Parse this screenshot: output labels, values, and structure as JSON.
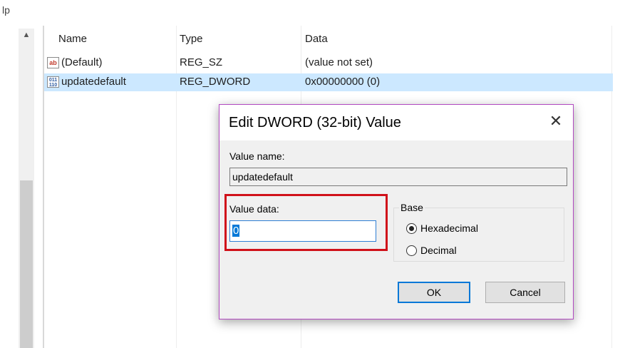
{
  "menu": {
    "fragment": "lp"
  },
  "list": {
    "columns": {
      "name": "Name",
      "type": "Type",
      "data": "Data"
    },
    "rows": [
      {
        "icon": "ab",
        "name": "(Default)",
        "type": "REG_SZ",
        "data": "(value not set)"
      },
      {
        "icon": "011\n110",
        "name": "updatedefault",
        "type": "REG_DWORD",
        "data": "0x00000000 (0)"
      }
    ]
  },
  "dialog": {
    "title": "Edit DWORD (32-bit) Value",
    "close_glyph": "✕",
    "value_name_label": "Value name:",
    "value_name": "updatedefault",
    "value_data_label": "Value data:",
    "value_data": "0",
    "base_label": "Base",
    "base_options": [
      "Hexadecimal",
      "Decimal"
    ],
    "base_selected": "Hexadecimal",
    "ok_label": "OK",
    "cancel_label": "Cancel"
  },
  "colors": {
    "selection": "#cce8ff",
    "highlight_box": "#d0111a",
    "dialog_border": "#b24ac1",
    "focus": "#0078d7"
  },
  "icons": {
    "scroll_up": "scroll-up-arrow-icon",
    "string_value": "reg-sz-icon",
    "dword_value": "reg-dword-icon",
    "close": "close-icon"
  }
}
